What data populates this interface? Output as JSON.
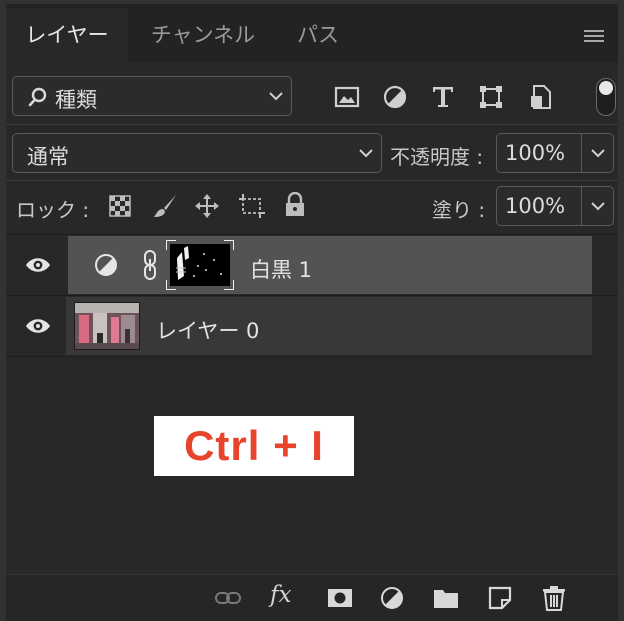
{
  "tabs": [
    {
      "label": "レイヤー",
      "active": true
    },
    {
      "label": "チャンネル",
      "active": false
    },
    {
      "label": "パス",
      "active": false
    }
  ],
  "filter": {
    "label": "種類",
    "icons": [
      "image-filter-icon",
      "adjustment-filter-icon",
      "type-filter-icon",
      "shape-filter-icon",
      "smartobject-filter-icon",
      "filter-toggle-icon"
    ]
  },
  "blend": {
    "mode": "通常",
    "opacity_label": "不透明度 :",
    "opacity": "100%"
  },
  "lock": {
    "label": "ロック :",
    "icons": [
      "lock-transparent-icon",
      "lock-paint-icon",
      "lock-position-icon",
      "lock-artboard-icon",
      "lock-all-icon"
    ],
    "fill_label": "塗り :",
    "fill": "100%"
  },
  "layers": [
    {
      "name": "白黒 1",
      "type": "adjustment",
      "selected": true,
      "visible": true
    },
    {
      "name": "レイヤー 0",
      "type": "pixel",
      "selected": false,
      "visible": true
    }
  ],
  "overlay": {
    "text": "Ctrl + I",
    "color": "#e8432b"
  },
  "footer": {
    "icons": [
      "link-layers-icon",
      "fx-icon",
      "add-mask-icon",
      "new-adjustment-icon",
      "new-group-icon",
      "new-layer-icon",
      "delete-icon"
    ],
    "fx_label": "fx"
  }
}
